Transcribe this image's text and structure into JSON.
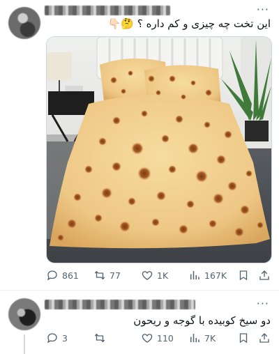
{
  "tweet1": {
    "text": "این تخت چه چیزی و کم داره ؟ 🤔👇🏻",
    "more": "···",
    "stats": {
      "replies": "861",
      "retweets": "77",
      "likes": "1K",
      "views": "167K"
    }
  },
  "tweet2": {
    "text_line1": "دو سیخ کوبیده با گوجه و ریحون",
    "more": "···",
    "stats": {
      "replies": "3",
      "retweets": "",
      "likes": "110",
      "views": "7K"
    }
  },
  "icons": {
    "reply": "reply-icon",
    "retweet": "retweet-icon",
    "like": "heart-icon",
    "views": "views-icon",
    "bookmark": "bookmark-icon",
    "share": "share-icon"
  },
  "colors": {
    "text": "#0f1419",
    "muted": "#536471",
    "divider": "#eff3f4"
  }
}
